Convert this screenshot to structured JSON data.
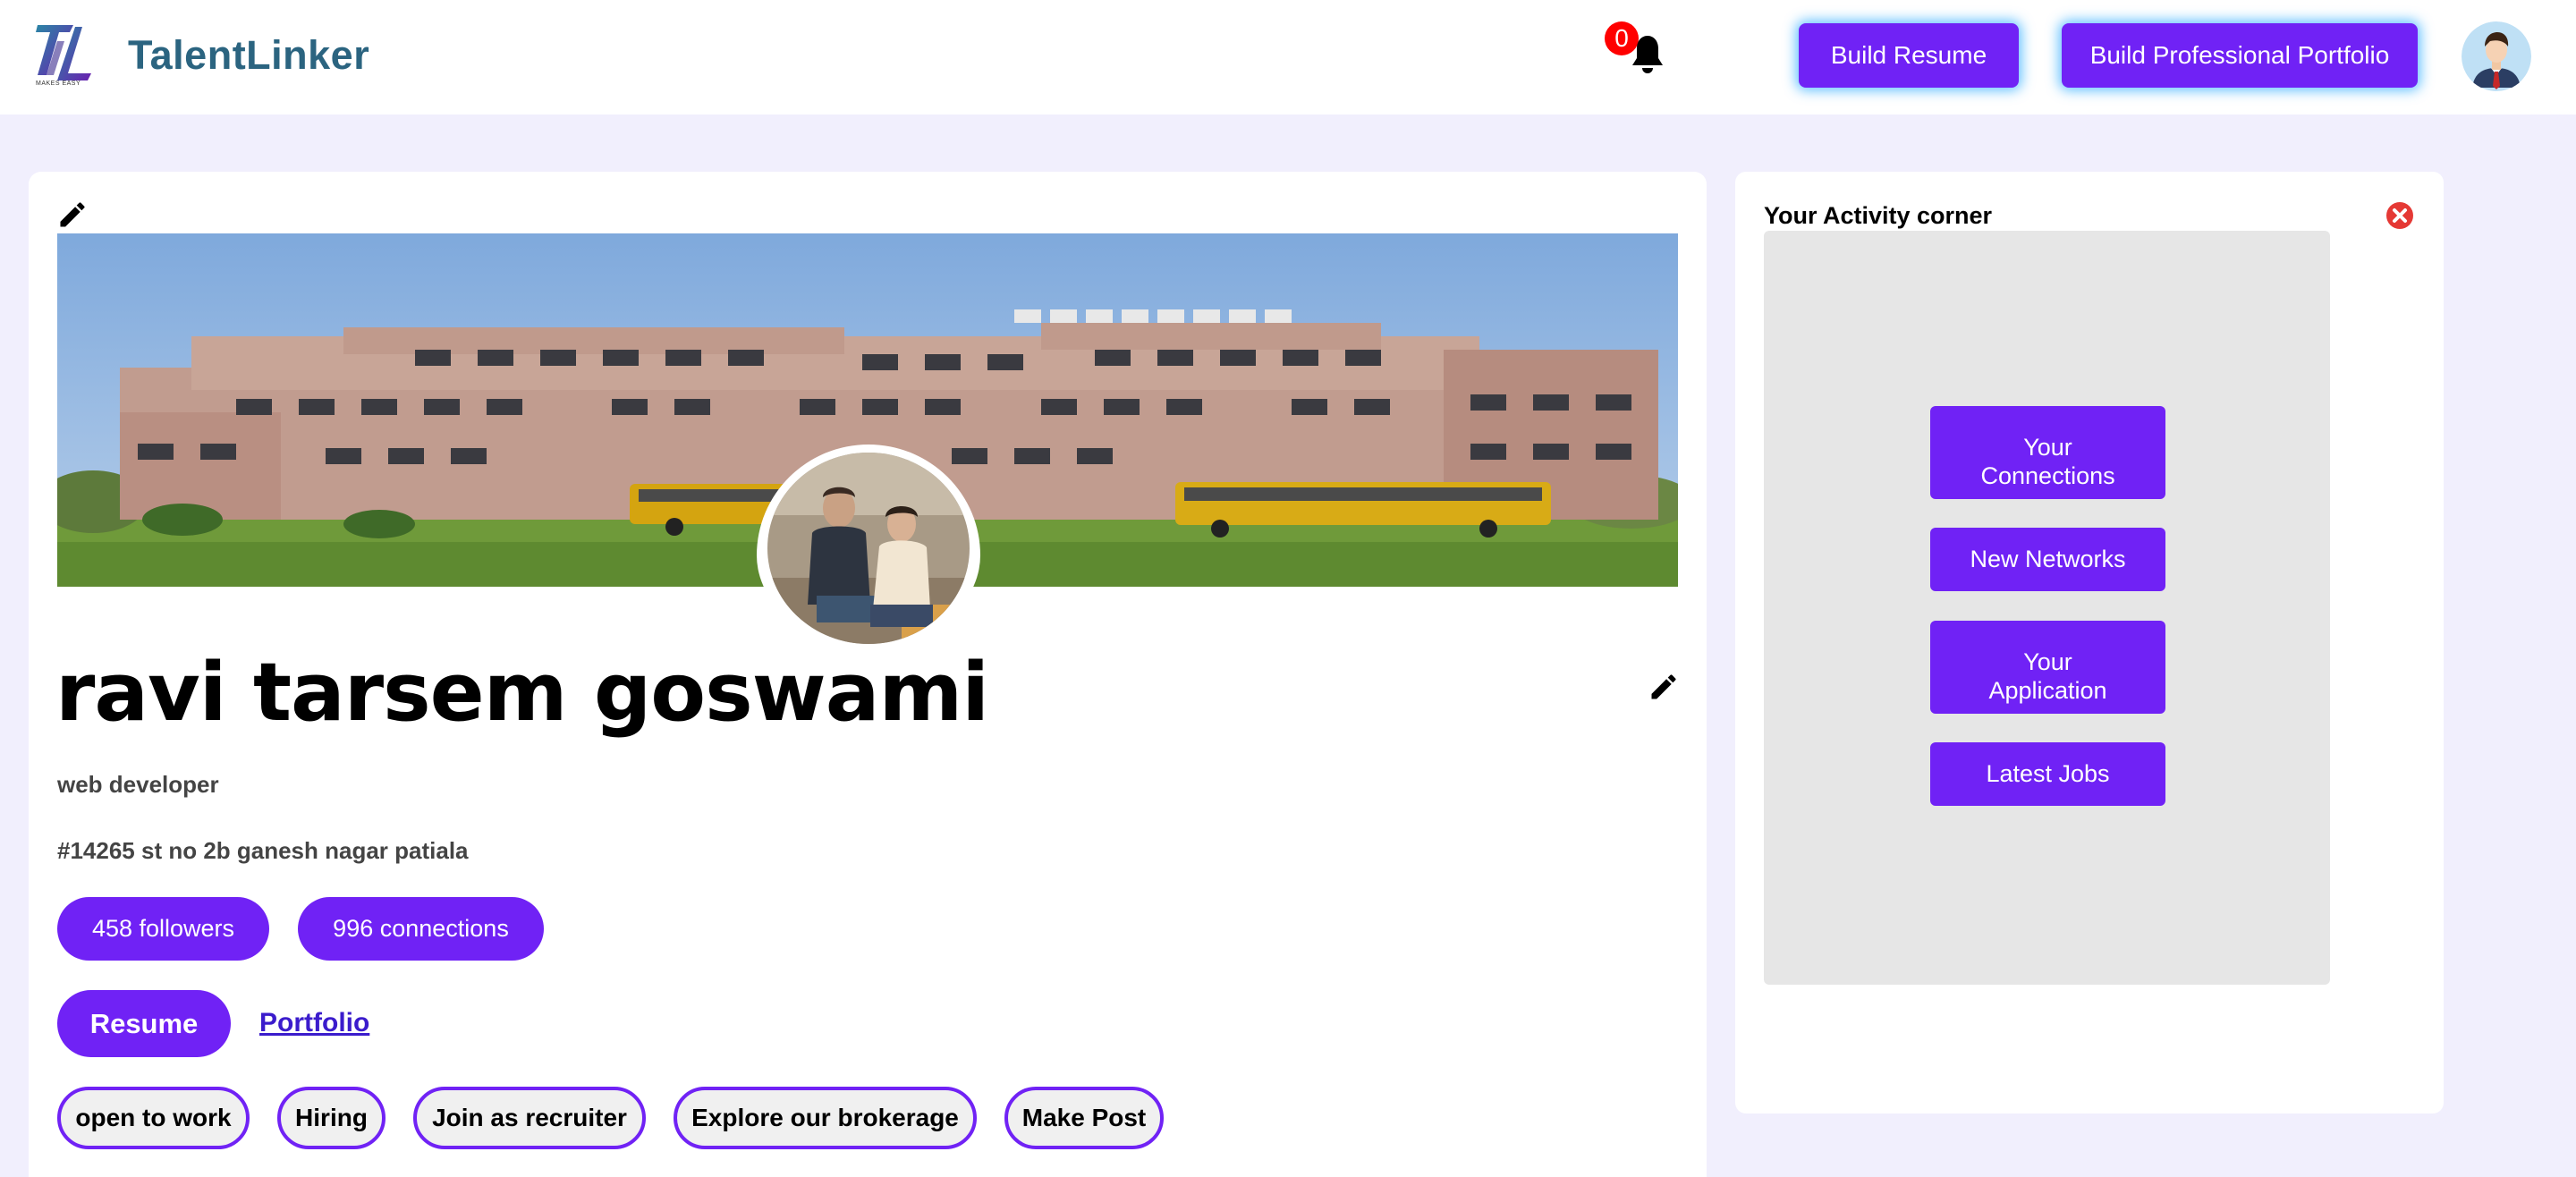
{
  "header": {
    "brand": "TalentLinker",
    "logo_caption": "MAKES EASY",
    "notification_count": "0",
    "build_resume": "Build Resume",
    "build_portfolio": "Build Professional Portfolio"
  },
  "profile": {
    "name": "ravi tarsem goswami",
    "title": "web developer",
    "address": "#14265 st no 2b ganesh nagar patiala",
    "followers": "458 followers",
    "connections": "996 connections",
    "resume_button": "Resume",
    "portfolio_link": "Portfolio",
    "tags": [
      "open to work",
      "Hiring",
      "Join as recruiter",
      "Explore our brokerage",
      "Make Post"
    ]
  },
  "activity": {
    "title": "Your Activity corner",
    "buttons": [
      "Your Connections",
      "New Networks",
      "Your Application",
      "Latest Jobs"
    ]
  },
  "colors": {
    "accent": "#7022f5",
    "page_bg": "#f1effd",
    "brand_text": "#2b6480",
    "badge": "#ff0000",
    "close": "#e53935"
  },
  "icons": {
    "cover_edit": "pencil-icon",
    "name_edit": "pencil-icon",
    "notification": "bell-icon",
    "activity_close": "close-circle-icon"
  }
}
